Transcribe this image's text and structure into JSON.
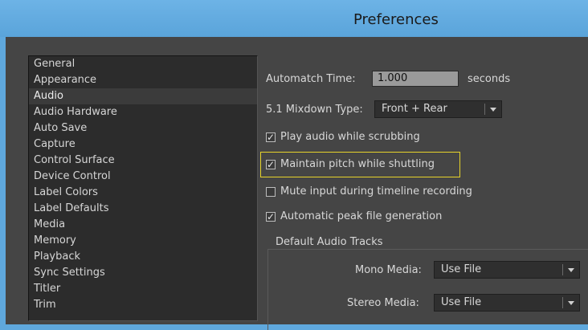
{
  "window": {
    "title": "Preferences"
  },
  "categories": {
    "selected_index": 2,
    "items": [
      "General",
      "Appearance",
      "Audio",
      "Audio Hardware",
      "Auto Save",
      "Capture",
      "Control Surface",
      "Device Control",
      "Label Colors",
      "Label Defaults",
      "Media",
      "Memory",
      "Playback",
      "Sync Settings",
      "Titler",
      "Trim"
    ]
  },
  "audio": {
    "automatch_label": "Automatch Time:",
    "automatch_value": "1.000",
    "automatch_unit": "seconds",
    "mixdown_label": "5.1 Mixdown Type:",
    "mixdown_value": "Front + Rear",
    "options": [
      {
        "label": "Play audio while scrubbing",
        "checked": true
      },
      {
        "label": "Maintain pitch while shuttling",
        "checked": true
      },
      {
        "label": "Mute input during timeline recording",
        "checked": false
      },
      {
        "label": "Automatic peak file generation",
        "checked": true
      }
    ],
    "default_tracks": {
      "title": "Default Audio Tracks",
      "mono_label": "Mono Media:",
      "mono_value": "Use File",
      "stereo_label": "Stereo Media:",
      "stereo_value": "Use File"
    }
  },
  "colors": {
    "highlight": "#e6d32a",
    "titlebar": "#5fa8dd",
    "panel": "#454545"
  }
}
